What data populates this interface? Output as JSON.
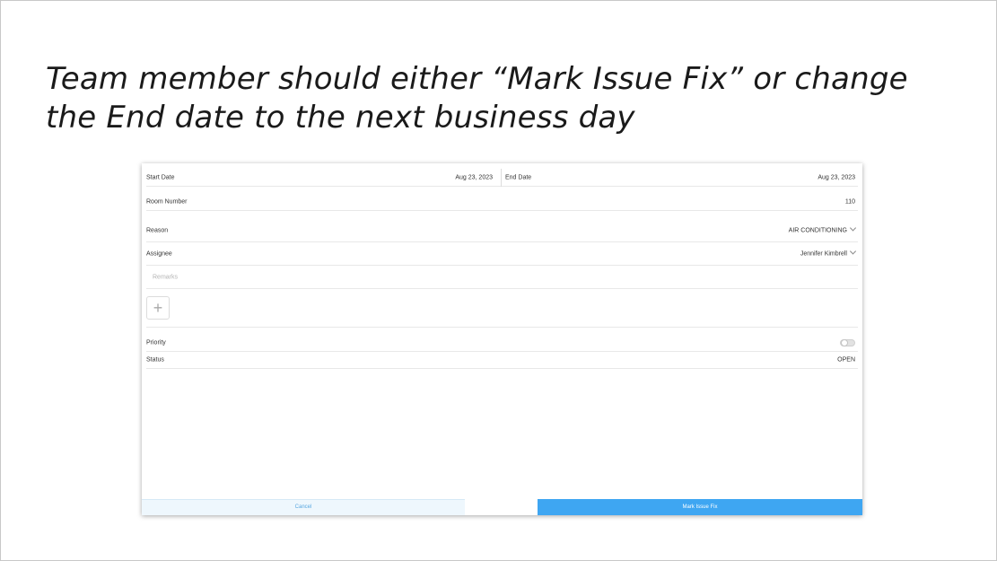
{
  "slide": {
    "headline_line1": "Team member should either “Mark Issue Fix” or change",
    "headline_line2": "the End date to the next business day"
  },
  "form": {
    "start_date": {
      "label": "Start Date",
      "value": "Aug 23, 2023"
    },
    "end_date": {
      "label": "End Date",
      "value": "Aug 23, 2023"
    },
    "room_number": {
      "label": "Room Number",
      "value": "110"
    },
    "reason": {
      "label": "Reason",
      "value": "AIR CONDITIONING"
    },
    "assignee": {
      "label": "Assignee",
      "value": "Jennifer Kimbrell"
    },
    "remarks": {
      "placeholder": "Remarks"
    },
    "add_button": {
      "icon": "plus-icon",
      "glyph": "+"
    },
    "priority": {
      "label": "Priority",
      "enabled": false
    },
    "status": {
      "label": "Status",
      "value": "OPEN"
    }
  },
  "actions": {
    "cancel_label": "Cancel",
    "mark_fix_label": "Mark Issue Fix"
  },
  "colors": {
    "accent": "#3ea6f2",
    "cancel_bg": "#eef7fd",
    "cancel_text": "#5aa8e0"
  }
}
